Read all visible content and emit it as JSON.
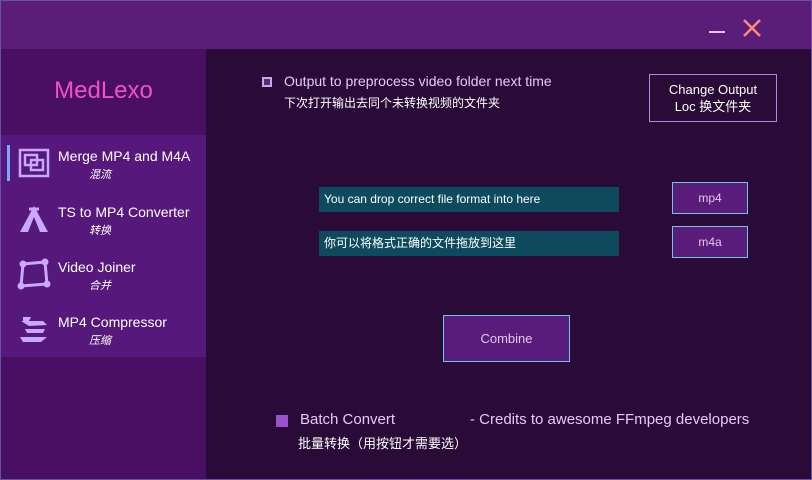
{
  "window": {
    "controls": {
      "minimize_icon": "minimize-icon",
      "close_icon": "close-icon",
      "close_color": "#ff8a7a"
    }
  },
  "sidebar": {
    "logo": "MedLexo",
    "logo_color": "#f052c0",
    "items": [
      {
        "label": "Merge MP4 and M4A",
        "sub": "混流",
        "icon": "merge-icon",
        "active": true
      },
      {
        "label": "TS to MP4 Converter",
        "sub": "转换",
        "icon": "convert-icon",
        "active": false
      },
      {
        "label": "Video Joiner",
        "sub": "合并",
        "icon": "joiner-icon",
        "active": false
      },
      {
        "label": "MP4 Compressor",
        "sub": "压缩",
        "icon": "compress-icon",
        "active": false
      }
    ]
  },
  "main": {
    "output_option": {
      "label": "Output to preprocess video folder next time",
      "label_cn": "下次打开输出去同个未转换视频的文件夹",
      "checked": true
    },
    "change_output": {
      "line1": "Change Output",
      "line2": "Loc 换文件夹"
    },
    "drop_mp4": "You can drop correct file format into here",
    "drop_m4a": "你可以将格式正确的文件拖放到这里",
    "mp4_button": "mp4",
    "m4a_button": "m4a",
    "combine_button": "Combine",
    "batch": {
      "label": "Batch Convert",
      "label_cn": "批量转换（用按钮才需要选）",
      "checked": false
    },
    "credits": "- Credits to awesome FFmpeg developers"
  }
}
